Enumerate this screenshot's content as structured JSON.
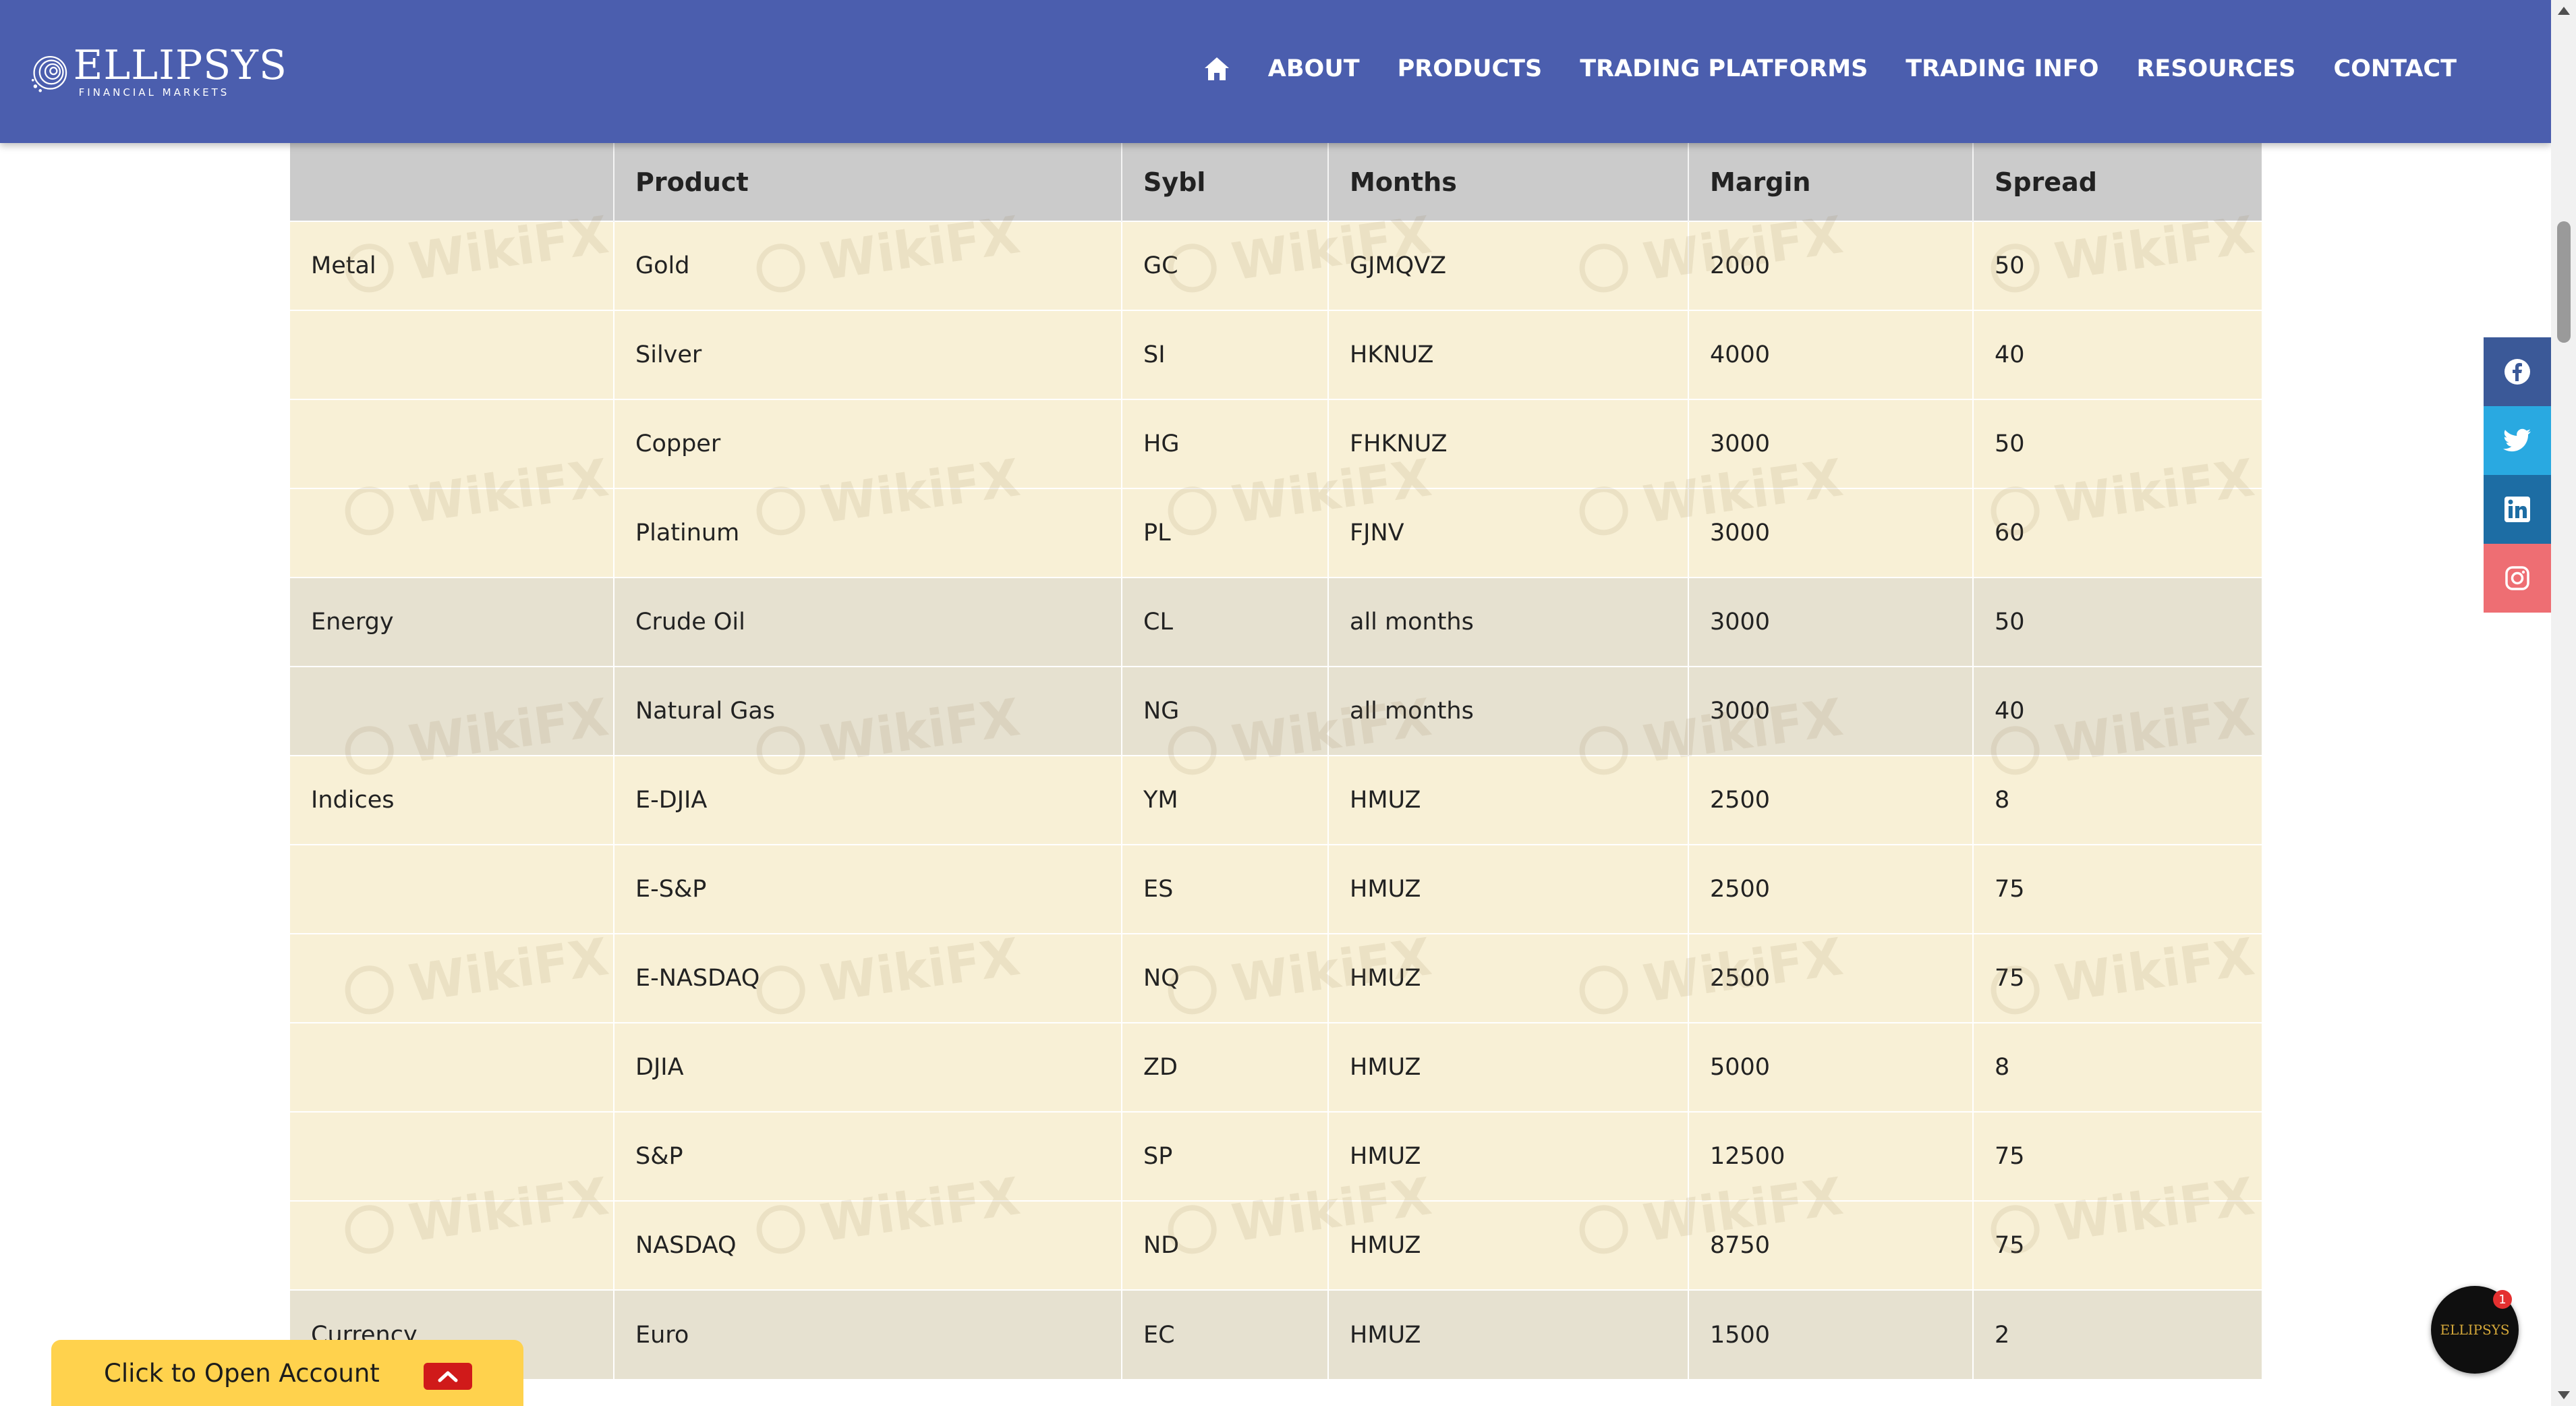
{
  "brand": {
    "name": "ELLIPSYS",
    "tagline": "FINANCIAL MARKETS",
    "chat_logo": "ELLIPSYS",
    "header_color": "#4b5eae"
  },
  "nav": {
    "home_icon": "home-icon",
    "items": [
      "ABOUT",
      "PRODUCTS",
      "TRADING PLATFORMS",
      "TRADING INFO",
      "RESOURCES",
      "CONTACT"
    ]
  },
  "table": {
    "headers": [
      "",
      "Product",
      "Sybl",
      "Months",
      "Margin",
      "Spread"
    ],
    "rows": [
      {
        "group": "metal",
        "category": "Metal",
        "product": "Gold",
        "symbol": "GC",
        "months": "GJMQVZ",
        "margin": "2000",
        "spread": "50"
      },
      {
        "group": "metal",
        "category": "",
        "product": "Silver",
        "symbol": "SI",
        "months": "HKNUZ",
        "margin": "4000",
        "spread": "40"
      },
      {
        "group": "metal",
        "category": "",
        "product": "Copper",
        "symbol": "HG",
        "months": "FHKNUZ",
        "margin": "3000",
        "spread": "50"
      },
      {
        "group": "metal",
        "category": "",
        "product": "Platinum",
        "symbol": "PL",
        "months": "FJNV",
        "margin": "3000",
        "spread": "60"
      },
      {
        "group": "energy",
        "category": "Energy",
        "product": "Crude Oil",
        "symbol": "CL",
        "months": "all months",
        "margin": "3000",
        "spread": "50"
      },
      {
        "group": "energy",
        "category": "",
        "product": "Natural Gas",
        "symbol": "NG",
        "months": "all months",
        "margin": "3000",
        "spread": "40"
      },
      {
        "group": "indices",
        "category": "Indices",
        "product": "E-DJIA",
        "symbol": "YM",
        "months": "HMUZ",
        "margin": "2500",
        "spread": "8"
      },
      {
        "group": "indices",
        "category": "",
        "product": "E-S&P",
        "symbol": "ES",
        "months": "HMUZ",
        "margin": "2500",
        "spread": "75"
      },
      {
        "group": "indices",
        "category": "",
        "product": "E-NASDAQ",
        "symbol": "NQ",
        "months": "HMUZ",
        "margin": "2500",
        "spread": "75"
      },
      {
        "group": "indices",
        "category": "",
        "product": "DJIA",
        "symbol": "ZD",
        "months": "HMUZ",
        "margin": "5000",
        "spread": "8"
      },
      {
        "group": "indices",
        "category": "",
        "product": "S&P",
        "symbol": "SP",
        "months": "HMUZ",
        "margin": "12500",
        "spread": "75"
      },
      {
        "group": "indices",
        "category": "",
        "product": "NASDAQ",
        "symbol": "ND",
        "months": "HMUZ",
        "margin": "8750",
        "spread": "75"
      },
      {
        "group": "currency",
        "category": "Currency",
        "product": "Euro",
        "symbol": "EC",
        "months": "HMUZ",
        "margin": "1500",
        "spread": "2"
      }
    ]
  },
  "social": [
    {
      "icon": "facebook-icon",
      "color": "#3b5998"
    },
    {
      "icon": "twitter-icon",
      "color": "#29a9e1"
    },
    {
      "icon": "linkedin-icon",
      "color": "#1d6da4"
    },
    {
      "icon": "instagram-icon",
      "color": "#ee6e73"
    }
  ],
  "watermark": "WikiFX",
  "open_account": {
    "label": "Click to Open Account",
    "caret_icon": "chevron-up-icon"
  },
  "chat": {
    "badge": "1"
  }
}
